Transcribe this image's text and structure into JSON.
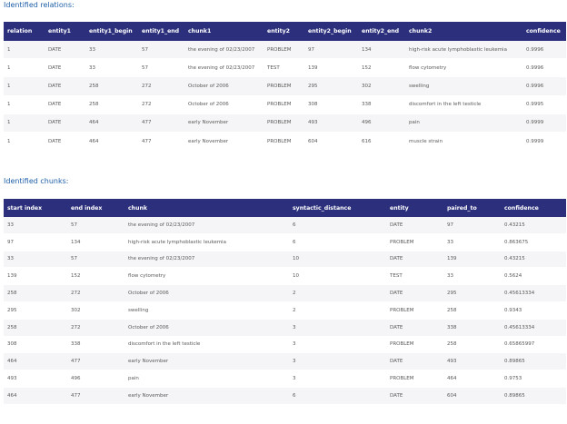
{
  "relations": {
    "title": "Identified relations:",
    "headers": [
      "relation",
      "entity1",
      "entity1_begin",
      "entity1_end",
      "chunk1",
      "entity2",
      "entity2_begin",
      "entity2_end",
      "chunk2",
      "confidence"
    ],
    "rows": [
      [
        "1",
        "DATE",
        "33",
        "57",
        "the evening of 02/23/2007",
        "PROBLEM",
        "97",
        "134",
        "high-risk acute lymphoblastic leukemia",
        "0.9996"
      ],
      [
        "1",
        "DATE",
        "33",
        "57",
        "the evening of 02/23/2007",
        "TEST",
        "139",
        "152",
        "flow cytometry",
        "0.9996"
      ],
      [
        "1",
        "DATE",
        "258",
        "272",
        "October of 2006",
        "PROBLEM",
        "295",
        "302",
        "swelling",
        "0.9996"
      ],
      [
        "1",
        "DATE",
        "258",
        "272",
        "October of 2006",
        "PROBLEM",
        "308",
        "338",
        "discomfort in the left testicle",
        "0.9995"
      ],
      [
        "1",
        "DATE",
        "464",
        "477",
        "early November",
        "PROBLEM",
        "493",
        "496",
        "pain",
        "0.9999"
      ],
      [
        "1",
        "DATE",
        "464",
        "477",
        "early November",
        "PROBLEM",
        "604",
        "616",
        "muscle strain",
        "0.9999"
      ]
    ]
  },
  "chunks": {
    "title": "Identified chunks:",
    "headers": [
      "start index",
      "end index",
      "chunk",
      "syntactic_distance",
      "entity",
      "paired_to",
      "confidence"
    ],
    "rows": [
      [
        "33",
        "57",
        "the evening of 02/23/2007",
        "6",
        "DATE",
        "97",
        "0.43215"
      ],
      [
        "97",
        "134",
        "high-risk acute lymphoblastic leukemia",
        "6",
        "PROBLEM",
        "33",
        "0.863675"
      ],
      [
        "33",
        "57",
        "the evening of 02/23/2007",
        "10",
        "DATE",
        "139",
        "0.43215"
      ],
      [
        "139",
        "152",
        "flow cytometry",
        "10",
        "TEST",
        "33",
        "0.5624"
      ],
      [
        "258",
        "272",
        "October of 2006",
        "2",
        "DATE",
        "295",
        "0.45613334"
      ],
      [
        "295",
        "302",
        "swelling",
        "2",
        "PROBLEM",
        "258",
        "0.9343"
      ],
      [
        "258",
        "272",
        "October of 2006",
        "3",
        "DATE",
        "338",
        "0.45613334"
      ],
      [
        "308",
        "338",
        "discomfort in the left testicle",
        "3",
        "PROBLEM",
        "258",
        "0.65865997"
      ],
      [
        "464",
        "477",
        "early November",
        "3",
        "DATE",
        "493",
        "0.89865"
      ],
      [
        "493",
        "496",
        "pain",
        "3",
        "PROBLEM",
        "464",
        "0.9753"
      ],
      [
        "464",
        "477",
        "early November",
        "6",
        "DATE",
        "604",
        "0.89865"
      ]
    ]
  }
}
